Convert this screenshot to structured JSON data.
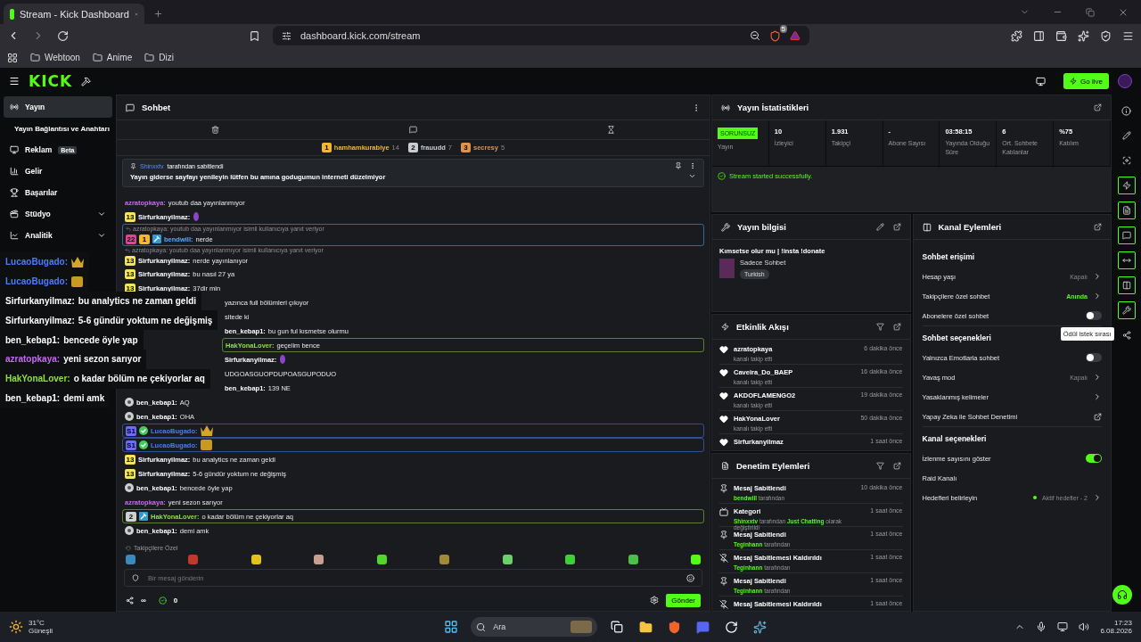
{
  "browser": {
    "tab_title": "Stream - Kick Dashboard",
    "url": "dashboard.kick.com/stream",
    "shield_count": "5",
    "bookmarks": [
      "Webtoon",
      "Anime",
      "Dizi"
    ]
  },
  "topbar": {
    "logo": "KICK",
    "go_live": "Go live"
  },
  "sidebar": {
    "items": [
      {
        "label": "Yayın",
        "selected": true,
        "expandable": false
      },
      {
        "label": "Yayın Bağlantısı ve Anahtarı",
        "selected": false,
        "expandable": false,
        "sub": true
      },
      {
        "label": "Reklam",
        "selected": false,
        "expandable": false,
        "badge": "Beta"
      },
      {
        "label": "Gelir",
        "selected": false,
        "expandable": false
      },
      {
        "label": "Başarılar",
        "selected": false,
        "expandable": false
      },
      {
        "label": "Stüdyo",
        "selected": false,
        "expandable": true
      },
      {
        "label": "Analitik",
        "selected": false,
        "expandable": true
      }
    ]
  },
  "chat": {
    "title": "Sohbet",
    "top_chatters": [
      {
        "rank": "1",
        "name": "hamhamkurabiye",
        "count": "14",
        "color": "#f5b82e"
      },
      {
        "rank": "2",
        "name": "frauudd",
        "count": "7",
        "color": "#c9ccd1"
      },
      {
        "rank": "3",
        "name": "secresy",
        "count": "5",
        "color": "#e0924a"
      }
    ],
    "pinned": {
      "by": "Shinxxtv",
      "by_suffix": "tarafından sabitlendi",
      "text": "Yayın giderse sayfayı yenileyin lütfen bu amına godugumun interneti düzelmiyor"
    },
    "messages": [
      {
        "user": "azratopkaya:",
        "color": "#c56bf0",
        "kind": "text",
        "text": "youtub daa yayınlanmıyor",
        "highlighted": false
      },
      {
        "badges": [
          {
            "kind": "number",
            "text": "13",
            "color": "#f2e55c"
          }
        ],
        "user": "Sirfurkanyilmaz:",
        "color": "#ffffff",
        "kind": "figure",
        "highlighted": false
      },
      {
        "reply": "azratopkaya: youtub daa yayınlanmıyor isimli kullanıcıya yanıt veriyor",
        "badges": [
          {
            "kind": "number",
            "text": "22",
            "color": "#e84393"
          },
          {
            "kind": "number",
            "text": "1",
            "color": "#f5b82e"
          },
          {
            "kind": "pick"
          }
        ],
        "user": "bendwill:",
        "color": "#5aa7ff",
        "kind": "text",
        "text": "nerde",
        "highlighted": true
      },
      {
        "reply": "azratopkaya: youtub daa yayınlanmıyor isimli kullanıcıya yanıt veriyor",
        "badges": [
          {
            "kind": "number",
            "text": "13",
            "color": "#f2e55c"
          }
        ],
        "user": "Sirfurkanyilmaz:",
        "color": "#ffffff",
        "kind": "text",
        "text": "nerde yayınlanıyor",
        "highlighted": false
      },
      {
        "badges": [
          {
            "kind": "number",
            "text": "13",
            "color": "#f2e55c"
          }
        ],
        "user": "Sirfurkanyilmaz:",
        "color": "#ffffff",
        "kind": "text",
        "text": "bu nasıl 27 ya",
        "highlighted": false
      },
      {
        "badges": [
          {
            "kind": "number",
            "text": "13",
            "color": "#f2e55c"
          }
        ],
        "user": "Sirfurkanyilmaz:",
        "color": "#ffffff",
        "kind": "text",
        "text": "37dir min",
        "highlighted": false
      },
      {
        "covered": true,
        "kind": "text",
        "text": "yazınca full bölümleri çıkıyor",
        "highlighted": false
      },
      {
        "covered": true,
        "kind": "text",
        "text": "sitede ki",
        "highlighted": false
      },
      {
        "covered": true,
        "user": "ben_kebap1:",
        "color": "#ffffff",
        "kind": "text",
        "text": "bu gun ful kısmetse olurmu",
        "highlighted": false
      },
      {
        "covered": true,
        "user": "HakYonaLover:",
        "color": "#8fe03a",
        "kind": "text",
        "text": "geçelim bence",
        "highlighted": true
      },
      {
        "covered": true,
        "user": "Sirfurkanyilmaz:",
        "color": "#ffffff",
        "kind": "figure",
        "highlighted": false
      },
      {
        "covered": true,
        "kind": "text",
        "text": "UDGOASGUOPDUPOASGUPODUO",
        "highlighted": false
      },
      {
        "covered": true,
        "user": "ben_kebap1:",
        "color": "#ffffff",
        "kind": "text",
        "text": "139 NE",
        "highlighted": false
      },
      {
        "badges": [
          {
            "kind": "circle"
          }
        ],
        "user": "ben_kebap1:",
        "color": "#ffffff",
        "kind": "text",
        "text": "AQ",
        "highlighted": false
      },
      {
        "badges": [
          {
            "kind": "circle"
          }
        ],
        "user": "ben_kebap1:",
        "color": "#ffffff",
        "kind": "text",
        "text": "OHA",
        "highlighted": false
      },
      {
        "badges": [
          {
            "kind": "number",
            "text": "S1",
            "color": "#6a6ff0"
          },
          {
            "kind": "verified"
          }
        ],
        "user": "LucaoBugado:",
        "color": "#4a7cff",
        "kind": "crown",
        "highlighted": true
      },
      {
        "badges": [
          {
            "kind": "number",
            "text": "S1",
            "color": "#6a6ff0"
          },
          {
            "kind": "verified"
          }
        ],
        "user": "LucaoBugado:",
        "color": "#4a7cff",
        "kind": "gold",
        "highlighted": true
      },
      {
        "badges": [
          {
            "kind": "number",
            "text": "13",
            "color": "#f2e55c"
          }
        ],
        "user": "Sirfurkanyilmaz:",
        "color": "#ffffff",
        "kind": "text",
        "text": "bu analytics ne zaman geldi",
        "highlighted": false
      },
      {
        "badges": [
          {
            "kind": "number",
            "text": "13",
            "color": "#f2e55c"
          }
        ],
        "user": "Sirfurkanyilmaz:",
        "color": "#ffffff",
        "kind": "text",
        "text": "5-6 gündür yoktum ne değişmiş",
        "highlighted": false
      },
      {
        "badges": [
          {
            "kind": "circle"
          }
        ],
        "user": "ben_kebap1:",
        "color": "#ffffff",
        "kind": "text",
        "text": "bencede öyle yap",
        "highlighted": false
      },
      {
        "user": "azratopkaya:",
        "color": "#c56bf0",
        "kind": "text",
        "text": "yeni sezon sarıyor",
        "highlighted": false
      },
      {
        "badges": [
          {
            "kind": "number",
            "text": "2",
            "color": "#d0d0d0"
          },
          {
            "kind": "pick"
          }
        ],
        "user": "HakYonaLover:",
        "color": "#8fe03a",
        "kind": "text",
        "text": "o kadar bölüm ne çekiyorlar aq",
        "highlighted": true
      },
      {
        "badges": [
          {
            "kind": "circle"
          }
        ],
        "user": "ben_kebap1:",
        "color": "#ffffff",
        "kind": "text",
        "text": "demi amk",
        "highlighted": false
      }
    ],
    "emote_label": "Takipçilere Özel",
    "placeholder": "Bir mesaj gönderin",
    "points_symbol": "∞",
    "balance": "0",
    "send": "Gönder"
  },
  "overlay": [
    {
      "user": "LucaoBugado:",
      "color": "#4a7cff",
      "kind": "crown"
    },
    {
      "user": "LucaoBugado:",
      "color": "#4a7cff",
      "kind": "gold"
    },
    {
      "user": "Sirfurkanyilmaz:",
      "color": "#ffffff",
      "kind": "text",
      "text": "bu analytics ne zaman geldi"
    },
    {
      "user": "Sirfurkanyilmaz:",
      "color": "#ffffff",
      "kind": "text",
      "text": "5-6 gündür yoktum ne değişmiş"
    },
    {
      "user": "ben_kebap1:",
      "color": "#ffffff",
      "kind": "text",
      "text": "bencede öyle yap"
    },
    {
      "user": "azratopkaya:",
      "color": "#c56bf0",
      "kind": "text",
      "text": "yeni sezon sarıyor"
    },
    {
      "user": "HakYonaLover:",
      "color": "#8fe03a",
      "kind": "text",
      "text": "o kadar bölüm ne çekiyorlar aq"
    },
    {
      "user": "ben_kebap1:",
      "color": "#ffffff",
      "kind": "text",
      "text": "demi amk"
    }
  ],
  "stats": {
    "title": "Yayın İstatistikleri",
    "cells": [
      {
        "kind": "status",
        "value": "SORUNSUZ",
        "label": "Yayın"
      },
      {
        "kind": "number",
        "value": "10",
        "label": "İzleyici"
      },
      {
        "kind": "number",
        "value": "1.931",
        "label": "Takipçi"
      },
      {
        "kind": "number",
        "value": "-",
        "label": "Abone Sayısı"
      },
      {
        "kind": "number",
        "value": "03:58:15",
        "label": "Yayında Olduğu Süre"
      },
      {
        "kind": "number",
        "value": "6",
        "label": "Ort. Sohbete Katılanlar"
      },
      {
        "kind": "number",
        "value": "%75",
        "label": "Katılım"
      }
    ],
    "message": "Stream started successfully."
  },
  "stream_info": {
    "title": "Yayın bilgisi",
    "stream_title": "Kımsetse olur mu | !insta !donate",
    "category": "Sadece Sohbet",
    "tag": "Turkish"
  },
  "activity": {
    "title": "Etkinlik Akışı",
    "items": [
      {
        "user": "azratopkaya",
        "action": "kanalı takip etti",
        "time": "6 dakika önce"
      },
      {
        "user": "Caveira_Do_BAEP",
        "action": "kanalı takip etti",
        "time": "16 dakika önce"
      },
      {
        "user": "AKDOFLAMENGO2",
        "action": "kanalı takip etti",
        "time": "19 dakika önce"
      },
      {
        "user": "HakYonaLover",
        "action": "kanalı takip etti",
        "time": "50 dakika önce"
      },
      {
        "user": "Sirfurkanyilmaz",
        "time": "1 saat önce"
      }
    ]
  },
  "mod_actions": {
    "title": "Denetim Eylemleri",
    "items": [
      {
        "kind": "pin",
        "title": "Mesaj Sabitlendi",
        "time": "10 dakika önce",
        "detail": "**bendwill** tarafından"
      },
      {
        "kind": "category",
        "title": "Kategori",
        "time": "1 saat önce",
        "detail": "**Shinxxtv** tarafından **Just Chatting** olarak değiştirildi"
      },
      {
        "kind": "pin",
        "title": "Mesaj Sabitlendi",
        "time": "1 saat önce",
        "detail": "**Teginhann** tarafından"
      },
      {
        "kind": "unpin",
        "title": "Mesaj Sabitlemesi Kaldırıldı",
        "time": "1 saat önce",
        "detail": "**Teginhann** tarafından"
      },
      {
        "kind": "pin",
        "title": "Mesaj Sabitlendi",
        "time": "1 saat önce",
        "detail": "**Teginhann** tarafından"
      },
      {
        "kind": "unpin",
        "title": "Mesaj Sabitlemesi Kaldırıldı",
        "time": "1 saat önce"
      }
    ]
  },
  "channel_actions": {
    "title": "Kanal Eylemleri",
    "sections": [
      {
        "title": "Sohbet erişimi",
        "rows": [
          {
            "kind": "value",
            "label": "Hesap yaşı",
            "value": "Kapalı",
            "active": false
          },
          {
            "kind": "value",
            "label": "Takipçilere özel sohbet",
            "value": "Anında",
            "active": true
          },
          {
            "kind": "toggle",
            "label": "Abonelere özel sohbet",
            "on": false
          }
        ]
      },
      {
        "title": "Sohbet seçenekleri",
        "rows": [
          {
            "kind": "toggle",
            "label": "Yalnızca Emotlarla sohbet",
            "on": false
          },
          {
            "kind": "value",
            "label": "Yavaş mod",
            "value": "Kapalı",
            "active": false
          },
          {
            "kind": "link",
            "label": "Yasaklanmış kelimeler"
          },
          {
            "kind": "external",
            "label": "Yapay Zeka ile Sohbet Denetimi"
          }
        ]
      },
      {
        "title": "Kanal seçenekleri",
        "rows": [
          {
            "kind": "toggle",
            "label": "İzlenme sayısını göster",
            "on": true
          },
          {
            "kind": "plain",
            "label": "Raid Kanalı"
          },
          {
            "kind": "goal",
            "label": "Hedefleri belirleyin",
            "value": "Aktif hedefler - 2"
          }
        ]
      }
    ]
  },
  "tooltip": "Ödül istek sırası",
  "taskbar": {
    "temperature": "31°C",
    "weather": "Güneşli",
    "search": "Ara",
    "time": "17:23",
    "date": "6.08.2026"
  }
}
